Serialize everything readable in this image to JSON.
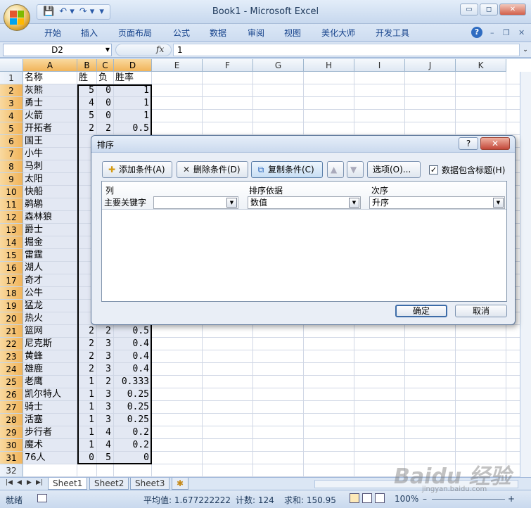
{
  "window": {
    "title": "Book1 - Microsoft Excel"
  },
  "quick_access": {
    "icons": [
      "save-icon",
      "undo-icon",
      "redo-icon",
      "customize-icon"
    ],
    "save": "💾",
    "undo": "↶ ▾",
    "redo": "↷ ▾",
    "customize": "▾"
  },
  "window_controls": {
    "minimize": "▭",
    "restore": "◻",
    "close": "✕"
  },
  "ribbon": {
    "tabs": [
      "开始",
      "插入",
      "页面布局",
      "公式",
      "数据",
      "审阅",
      "视图",
      "美化大师",
      "开发工具"
    ],
    "help": "?",
    "mini_controls": [
      "–",
      "❐",
      "✕"
    ]
  },
  "formula_bar": {
    "name_box": "D2",
    "fx": "fx",
    "value": "1",
    "dropdown": "▼",
    "expand": "⌄"
  },
  "sheet": {
    "columns": [
      "A",
      "B",
      "C",
      "D",
      "E",
      "F",
      "G",
      "H",
      "I",
      "J",
      "K"
    ],
    "header_row": {
      "name": "名称",
      "win": "胜",
      "loss": "负",
      "rate": "胜率"
    },
    "rows": [
      {
        "r": "2",
        "name": "灰熊",
        "win": "5",
        "loss": "0",
        "rate": "1"
      },
      {
        "r": "3",
        "name": "勇士",
        "win": "4",
        "loss": "0",
        "rate": "1"
      },
      {
        "r": "4",
        "name": "火箭",
        "win": "5",
        "loss": "0",
        "rate": "1"
      },
      {
        "r": "5",
        "name": "开拓者",
        "win": "2",
        "loss": "2",
        "rate": "0.5"
      },
      {
        "r": "6",
        "name": "国王",
        "win": "",
        "loss": "",
        "rate": ""
      },
      {
        "r": "7",
        "name": "小牛",
        "win": "",
        "loss": "",
        "rate": ""
      },
      {
        "r": "8",
        "name": "马刺",
        "win": "",
        "loss": "",
        "rate": ""
      },
      {
        "r": "9",
        "name": "太阳",
        "win": "",
        "loss": "",
        "rate": ""
      },
      {
        "r": "10",
        "name": "快船",
        "win": "",
        "loss": "",
        "rate": ""
      },
      {
        "r": "11",
        "name": "鹈鹕",
        "win": "",
        "loss": "",
        "rate": ""
      },
      {
        "r": "12",
        "name": "森林狼",
        "win": "",
        "loss": "",
        "rate": ""
      },
      {
        "r": "13",
        "name": "爵士",
        "win": "",
        "loss": "",
        "rate": ""
      },
      {
        "r": "14",
        "name": "掘金",
        "win": "",
        "loss": "",
        "rate": ""
      },
      {
        "r": "15",
        "name": "雷霆",
        "win": "",
        "loss": "",
        "rate": ""
      },
      {
        "r": "16",
        "name": "湖人",
        "win": "",
        "loss": "",
        "rate": ""
      },
      {
        "r": "17",
        "name": "奇才",
        "win": "",
        "loss": "",
        "rate": ""
      },
      {
        "r": "18",
        "name": "公牛",
        "win": "",
        "loss": "",
        "rate": ""
      },
      {
        "r": "19",
        "name": "猛龙",
        "win": "",
        "loss": "",
        "rate": ""
      },
      {
        "r": "20",
        "name": "热火",
        "win": "",
        "loss": "",
        "rate": ""
      },
      {
        "r": "21",
        "name": "篮网",
        "win": "2",
        "loss": "2",
        "rate": "0.5"
      },
      {
        "r": "22",
        "name": "尼克斯",
        "win": "2",
        "loss": "3",
        "rate": "0.4"
      },
      {
        "r": "23",
        "name": "黄蜂",
        "win": "2",
        "loss": "3",
        "rate": "0.4"
      },
      {
        "r": "24",
        "name": "雄鹿",
        "win": "2",
        "loss": "3",
        "rate": "0.4"
      },
      {
        "r": "25",
        "name": "老鹰",
        "win": "1",
        "loss": "2",
        "rate": "0.333"
      },
      {
        "r": "26",
        "name": "凯尔特人",
        "win": "1",
        "loss": "3",
        "rate": "0.25"
      },
      {
        "r": "27",
        "name": "骑士",
        "win": "1",
        "loss": "3",
        "rate": "0.25"
      },
      {
        "r": "28",
        "name": "活塞",
        "win": "1",
        "loss": "3",
        "rate": "0.25"
      },
      {
        "r": "29",
        "name": "步行者",
        "win": "1",
        "loss": "4",
        "rate": "0.2"
      },
      {
        "r": "30",
        "name": "魔术",
        "win": "1",
        "loss": "4",
        "rate": "0.2"
      },
      {
        "r": "31",
        "name": "76人",
        "win": "0",
        "loss": "5",
        "rate": "0"
      }
    ],
    "last_row": "32",
    "first_row": "1"
  },
  "sheet_tabs": {
    "nav": [
      "|◀",
      "◀",
      "▶",
      "▶|"
    ],
    "tabs": [
      "Sheet1",
      "Sheet2",
      "Sheet3"
    ],
    "add": "✱"
  },
  "status": {
    "mode": "就绪",
    "average": "平均值: 1.677222222",
    "count": "计数: 124",
    "sum": "求和: 150.95",
    "zoom": "100%",
    "zoom_minus": "–",
    "zoom_plus": "+"
  },
  "sort_dialog": {
    "title": "排序",
    "help": "?",
    "close": "✕",
    "add_level": "添加条件(A)",
    "delete_level": "删除条件(D)",
    "copy_level": "复制条件(C)",
    "move_up": "▲",
    "move_down": "▼",
    "options": "选项(O)...",
    "has_headers": "数据包含标题(H)",
    "has_headers_checked": "✓",
    "col_header_column": "列",
    "col_header_sorton": "排序依据",
    "col_header_order": "次序",
    "row_label": "主要关键字",
    "sort_by_value": "",
    "sort_on_value": "数值",
    "order_value": "升序",
    "ok": "确定",
    "cancel": "取消"
  },
  "watermark": {
    "text": "Baidu 经验",
    "sub": "jingyan.baidu.com"
  },
  "colors": {
    "selected_header": "#f1b45a",
    "ribbon_text": "#15428b",
    "selection_fill": "#e3e8f3"
  }
}
